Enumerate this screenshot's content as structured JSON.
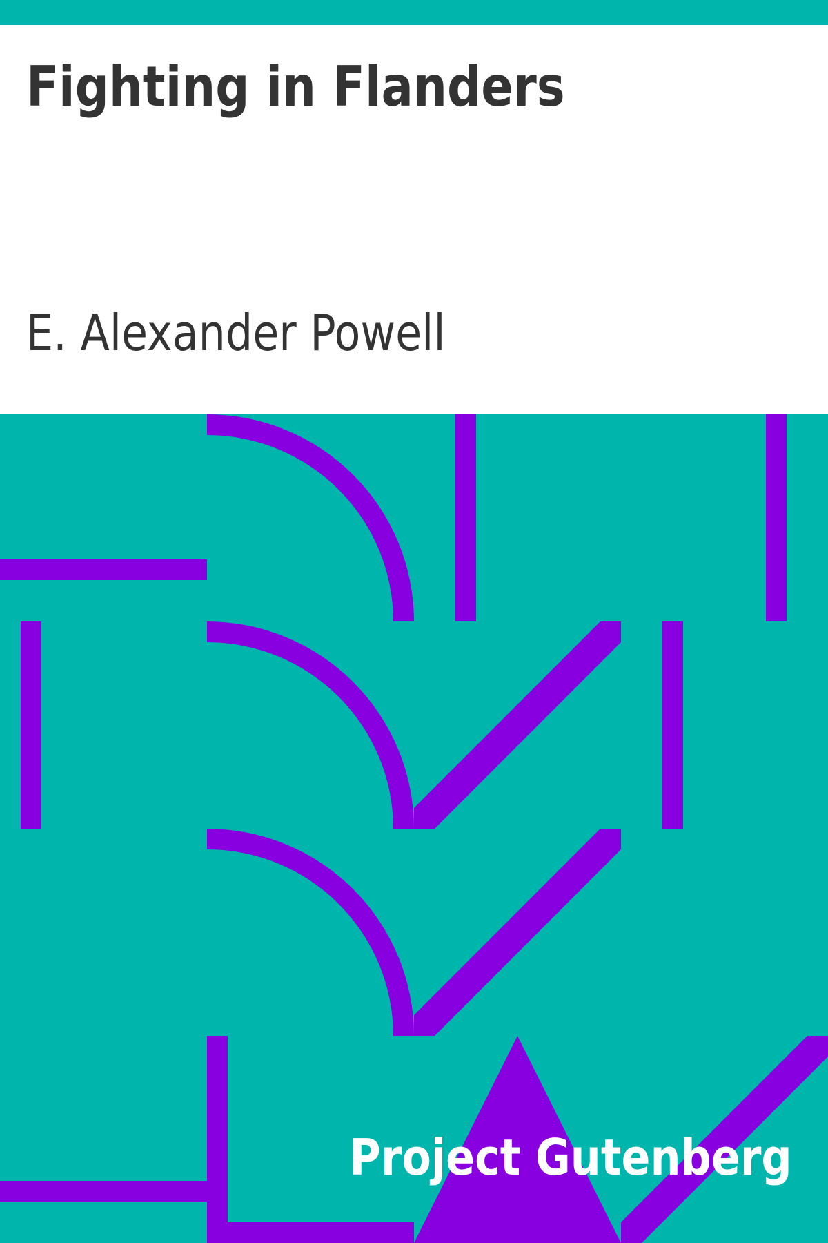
{
  "cover": {
    "title": "Fighting in Flanders",
    "author": "E. Alexander Powell",
    "publisher": "Project Gutenberg"
  },
  "colors": {
    "background": "#00b5ab",
    "pattern": "#8800e0",
    "title_text": "#333333",
    "publisher_text": "#ffffff",
    "page": "#ffffff"
  }
}
